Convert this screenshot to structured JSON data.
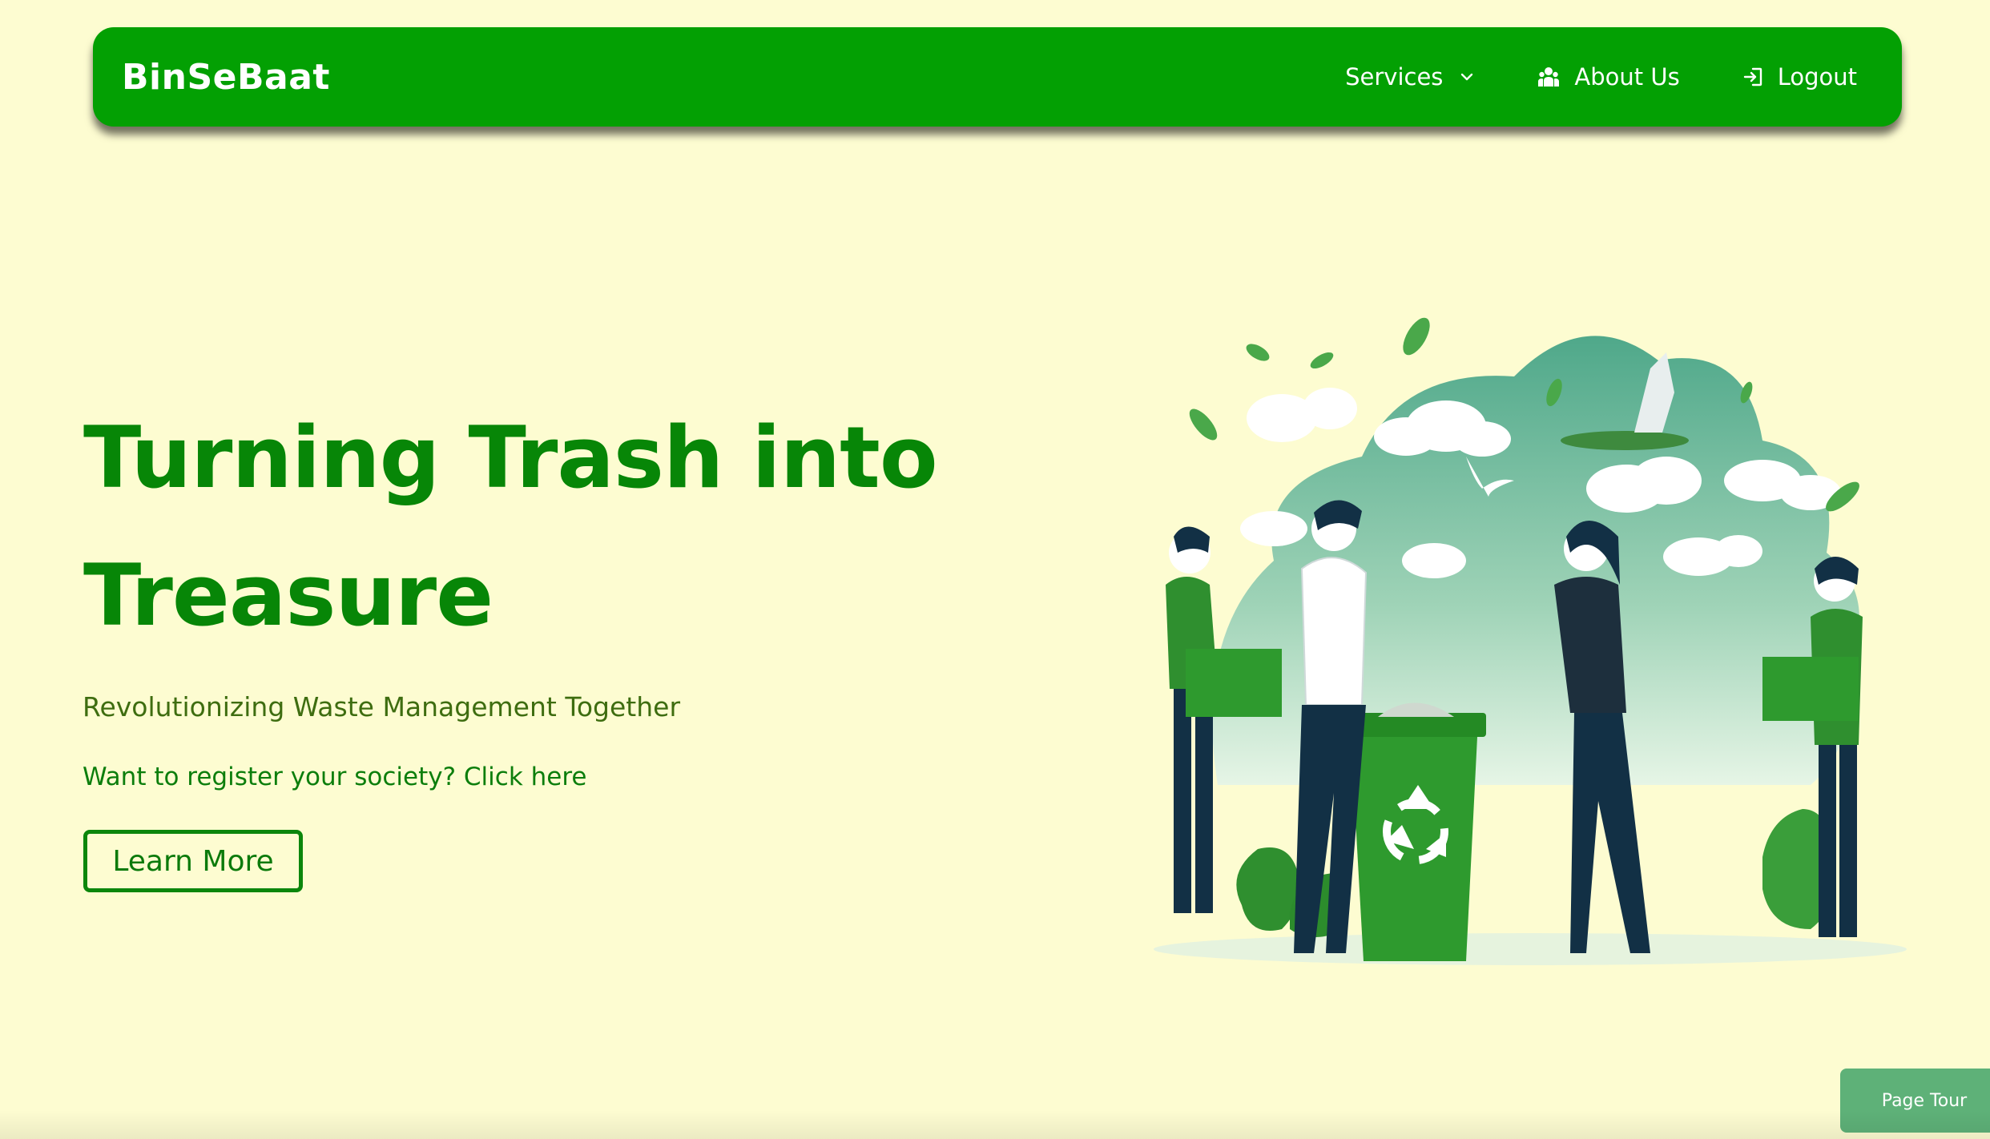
{
  "navbar": {
    "brand": "BinSeBaat",
    "services_label": "Services",
    "about_label": "About Us",
    "logout_label": "Logout"
  },
  "hero": {
    "title": "Turning Trash into Treasure",
    "subtitle": "Revolutionizing Waste Management Together",
    "register_text": "Want to register your society? Click here",
    "learn_more_label": "Learn More"
  },
  "page_tour_label": "Page Tour",
  "colors": {
    "background": "#fdfcd1",
    "navbar": "#03a003",
    "primary_green": "#078607",
    "page_tour": "#5eb178"
  },
  "icons": [
    "chevron-down-icon",
    "people-icon",
    "login-icon"
  ]
}
